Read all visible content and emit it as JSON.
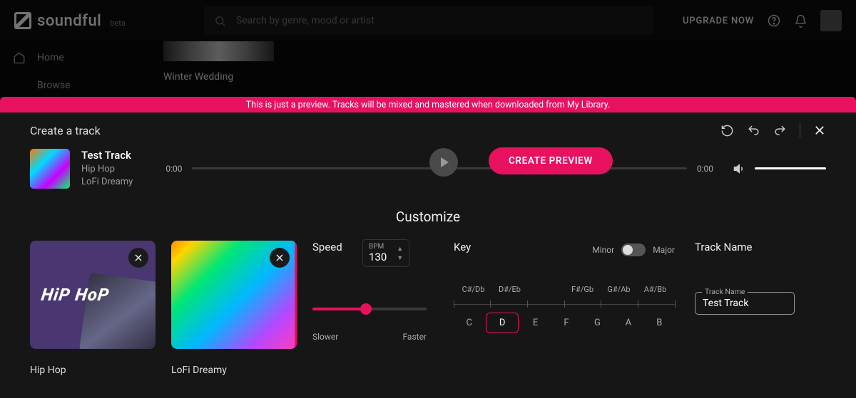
{
  "header": {
    "brand": "soundful",
    "badge": "beta",
    "search_placeholder": "Search by genre, mood or artist",
    "upgrade_label": "UPGRADE NOW"
  },
  "sidebar": {
    "items": [
      {
        "label": "Home"
      },
      {
        "label": "Browse"
      }
    ]
  },
  "background": {
    "thumb_label": "Winter Wedding"
  },
  "banner": {
    "text": "This is just a preview. Tracks will be mixed and mastered when downloaded from My Library."
  },
  "panel": {
    "title": "Create a track",
    "track_name": "Test Track",
    "track_genre": "Hip Hop",
    "track_style": "LoFi Dreamy",
    "time_current": "0:00",
    "time_total": "0:00",
    "create_button": "CREATE PREVIEW"
  },
  "customize": {
    "title": "Customize",
    "cards": [
      {
        "label": "Hip Hop"
      },
      {
        "label": "LoFi Dreamy"
      }
    ],
    "speed": {
      "label": "Speed",
      "bpm_label": "BPM",
      "bpm_value": "130",
      "slower": "Slower",
      "faster": "Faster"
    },
    "key": {
      "label": "Key",
      "minor": "Minor",
      "major": "Major",
      "sharps": [
        "C#/Db",
        "D#/Eb",
        "",
        "F#/Gb",
        "G#/Ab",
        "A#/Bb"
      ],
      "notes": [
        "C",
        "D",
        "E",
        "F",
        "G",
        "A",
        "B"
      ],
      "selected": "D"
    },
    "track_name": {
      "heading": "Track Name",
      "field_label": "Track Name",
      "value": "Test Track"
    }
  }
}
